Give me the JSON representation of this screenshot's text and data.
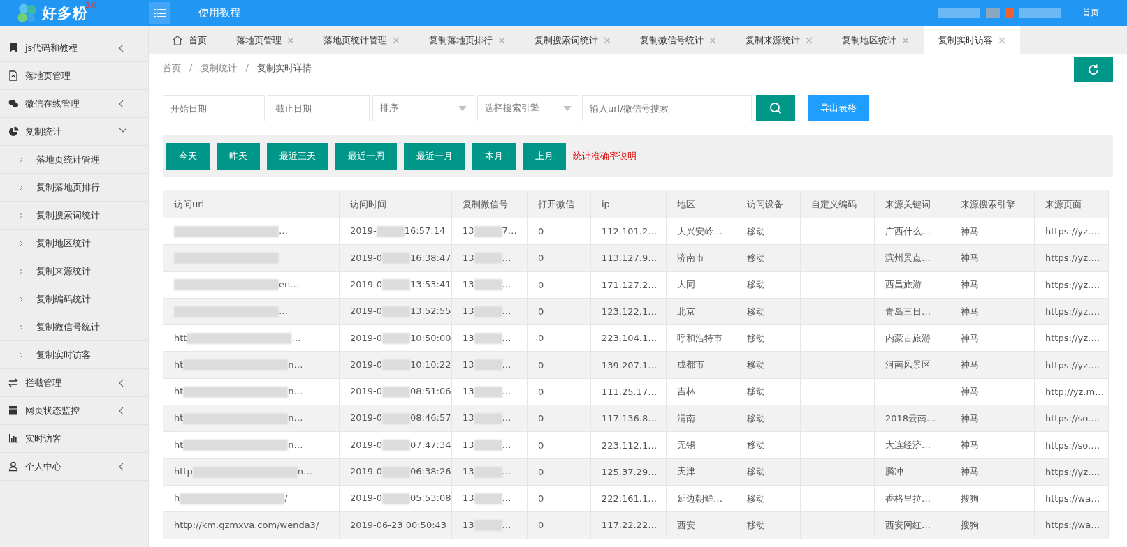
{
  "header": {
    "logo": "好多粉",
    "version": "3.0",
    "nav": "使用教程",
    "right_link": "首页"
  },
  "sidebar": {
    "items": [
      {
        "label": "js代码和教程",
        "kind": "bookmark",
        "expanded": false
      },
      {
        "label": "落地页管理",
        "kind": "file"
      },
      {
        "label": "微信在线管理",
        "kind": "wechat",
        "expanded": false
      },
      {
        "label": "复制统计",
        "kind": "pie",
        "expanded": true,
        "children": [
          {
            "label": "落地页统计管理"
          },
          {
            "label": "复制落地页排行"
          },
          {
            "label": "复制搜索词统计"
          },
          {
            "label": "复制地区统计"
          },
          {
            "label": "复制来源统计"
          },
          {
            "label": "复制编码统计"
          },
          {
            "label": "复制微信号统计"
          },
          {
            "label": "复制实时访客"
          }
        ]
      },
      {
        "label": "拦截管理",
        "kind": "swap",
        "expanded": false
      },
      {
        "label": "网页状态监控",
        "kind": "server",
        "expanded": false
      },
      {
        "label": "实时访客",
        "kind": "bars"
      },
      {
        "label": "个人中心",
        "kind": "user",
        "expanded": false
      }
    ]
  },
  "tabs": [
    {
      "label": "首页",
      "kind": "home",
      "selected": false
    },
    {
      "label": "落地页管理",
      "kind": "page",
      "selected": false
    },
    {
      "label": "落地页统计管理",
      "kind": "page",
      "selected": false
    },
    {
      "label": "复制落地页排行",
      "kind": "page",
      "selected": false
    },
    {
      "label": "复制搜索词统计",
      "kind": "page",
      "selected": false
    },
    {
      "label": "复制微信号统计",
      "kind": "page",
      "selected": false
    },
    {
      "label": "复制来源统计",
      "kind": "page",
      "selected": false
    },
    {
      "label": "复制地区统计",
      "kind": "page",
      "selected": false
    },
    {
      "label": "复制实时访客",
      "kind": "page",
      "selected": true
    }
  ],
  "breadcrumb": {
    "items": [
      "首页",
      "复制统计",
      "复制实时详情"
    ],
    "separator": "/"
  },
  "filters": {
    "fields": [
      {
        "placeholder": "开始日期",
        "kind": "input"
      },
      {
        "placeholder": "截止日期",
        "kind": "input"
      },
      {
        "placeholder": "排序",
        "kind": "select"
      },
      {
        "placeholder": "选择搜索引擎",
        "kind": "select"
      },
      {
        "placeholder": "输入url/微信号搜索",
        "kind": "search"
      }
    ],
    "export_button": "导出表格"
  },
  "quick_ranges": [
    "今天",
    "昨天",
    "最近三天",
    "最近一周",
    "最近一月",
    "本月",
    "上月"
  ],
  "accuracy_link": "统计准确率说明",
  "table": {
    "columns": [
      "访问url",
      "访问时间",
      "复制微信号",
      "打开微信",
      "ip",
      "地区",
      "访问设备",
      "自定义编码",
      "来源关键词",
      "来源搜索引擎",
      "来源页面"
    ],
    "rows": [
      {
        "url": {
          "end": "…"
        },
        "time": {
          "start": "2019-",
          "end": "16:57:14"
        },
        "wechat": {
          "start": "13",
          "end": "7…"
        },
        "open": "0",
        "ip": "112.101.2…",
        "region": "大兴安岭…",
        "device": "移动",
        "keyword": "广西什么…",
        "engine": "神马",
        "page": "https://yz.…"
      },
      {
        "url": {},
        "time": {
          "start": "2019-0",
          "end": "16:38:47"
        },
        "wechat": {
          "start": "13",
          "end": "…"
        },
        "open": "0",
        "ip": "113.127.9…",
        "region": "济南市",
        "device": "移动",
        "keyword": "滨州景点…",
        "engine": "神马",
        "page": "https://yz.…"
      },
      {
        "url": {
          "end": "en…"
        },
        "time": {
          "start": "2019-0",
          "end": "13:53:41"
        },
        "wechat": {
          "start": "13",
          "end": "…"
        },
        "open": "0",
        "ip": "171.127.2…",
        "region": "大同",
        "device": "移动",
        "keyword": "西昌旅游",
        "engine": "神马",
        "page": "https://yz.…"
      },
      {
        "url": {
          "end": "…"
        },
        "time": {
          "start": "2019-0",
          "end": "13:52:55"
        },
        "wechat": {
          "start": "13",
          "end": "…"
        },
        "open": "0",
        "ip": "123.122.1…",
        "region": "北京",
        "device": "移动",
        "keyword": "青岛三日…",
        "engine": "神马",
        "page": "https://yz.…"
      },
      {
        "url": {
          "start": "htt",
          "end": "…"
        },
        "time": {
          "start": "2019-0",
          "end": "10:50:00"
        },
        "wechat": {
          "start": "13",
          "end": "…"
        },
        "open": "0",
        "ip": "223.104.1…",
        "region": "呼和浩特市",
        "device": "移动",
        "keyword": "内蒙古旅游",
        "engine": "神马",
        "page": "https://yz.…"
      },
      {
        "url": {
          "start": "ht",
          "end": "n…"
        },
        "time": {
          "start": "2019-0",
          "end": "10:10:22"
        },
        "wechat": {
          "start": "13",
          "end": "…"
        },
        "open": "0",
        "ip": "139.207.1…",
        "region": "成都市",
        "device": "移动",
        "keyword": "河南风景区",
        "engine": "神马",
        "page": "https://yz.…"
      },
      {
        "url": {
          "start": "ht",
          "end": "n…"
        },
        "time": {
          "start": "2019-0",
          "end": "08:51:06"
        },
        "wechat": {
          "start": "13",
          "end": "…"
        },
        "open": "0",
        "ip": "111.25.17…",
        "region": "吉林",
        "device": "移动",
        "engine": "神马",
        "page": "http://yz.m…"
      },
      {
        "url": {
          "start": "ht",
          "end": "n…"
        },
        "time": {
          "start": "2019-0",
          "end": "08:46:57"
        },
        "wechat": {
          "start": "13",
          "end": "…"
        },
        "open": "0",
        "ip": "117.136.8…",
        "region": "渭南",
        "device": "移动",
        "keyword": "2018云南…",
        "engine": "神马",
        "page": "https://so.…"
      },
      {
        "url": {
          "start": "ht",
          "end": "n…"
        },
        "time": {
          "start": "2019-0",
          "end": "07:47:34"
        },
        "wechat": {
          "start": "13",
          "end": "…"
        },
        "open": "0",
        "ip": "223.112.1…",
        "region": "无锡",
        "device": "移动",
        "keyword": "大连经济…",
        "engine": "神马",
        "page": "https://so.…"
      },
      {
        "url": {
          "start": "http",
          "end": "n…"
        },
        "time": {
          "start": "2019-0",
          "end": "06:38:26"
        },
        "wechat": {
          "start": "13",
          "end": "…"
        },
        "open": "0",
        "ip": "125.37.29…",
        "region": "天津",
        "device": "移动",
        "keyword": "腾冲",
        "engine": "神马",
        "page": "https://yz.…"
      },
      {
        "url": {
          "start": "h",
          "end": "/"
        },
        "time": {
          "start": "2019-0",
          "end": "05:53:08"
        },
        "wechat": {
          "start": "13",
          "end": "…"
        },
        "open": "0",
        "ip": "222.161.1…",
        "region": "延边朝鲜…",
        "device": "移动",
        "keyword": "香格里拉…",
        "engine": "搜狗",
        "page": "https://wa…"
      },
      {
        "url": "http://km.gzmxva.com/wenda3/",
        "time": "2019-06-23 00:50:43",
        "wechat": {
          "start": "13",
          "end": "…"
        },
        "open": "0",
        "ip": "117.22.22…",
        "region": "西安",
        "device": "移动",
        "keyword": "西安网红…",
        "engine": "搜狗",
        "page": "https://wa…"
      }
    ]
  }
}
